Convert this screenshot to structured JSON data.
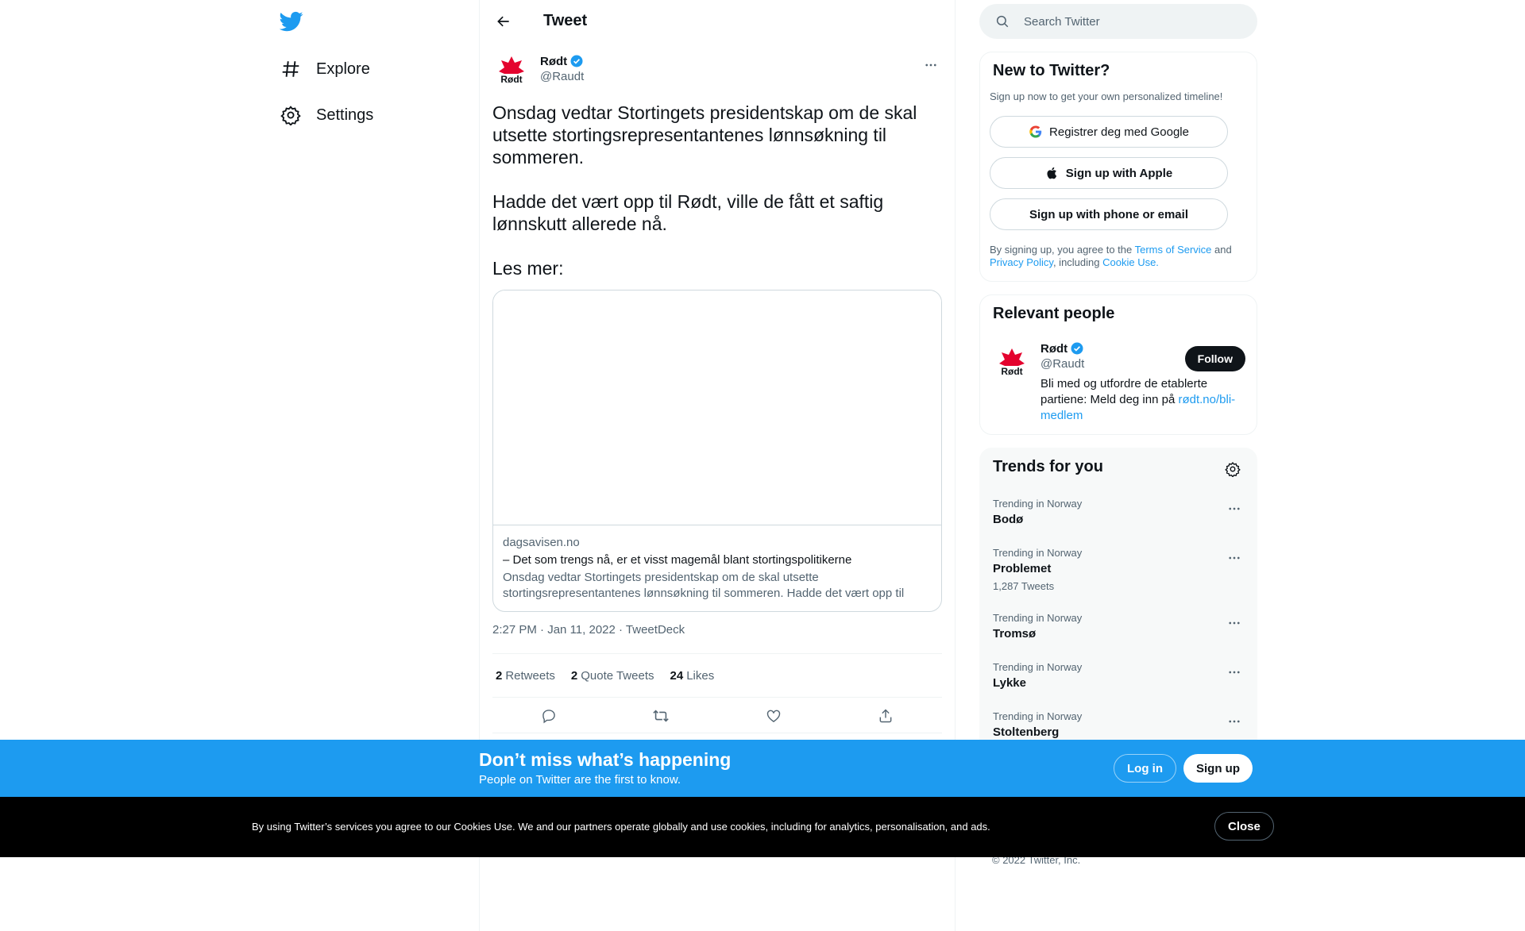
{
  "nav": {
    "items": [
      {
        "label": "Explore",
        "icon": "hashtag-icon"
      },
      {
        "label": "Settings",
        "icon": "gear-icon"
      }
    ]
  },
  "header": {
    "title": "Tweet"
  },
  "tweet": {
    "author_name": "Rødt",
    "author_handle": "@Raudt",
    "avatar_text": "Rødt",
    "paragraphs": [
      "Onsdag vedtar Stortingets presidentskap om de skal utsette stortingsrepresentantenes lønnsøkning til sommeren.",
      "Hadde det vært opp til Rødt, ville de fått et saftig lønnskutt allerede nå.",
      "Les mer:"
    ],
    "card": {
      "domain": "dagsavisen.no",
      "title": "– Det som trengs nå, er et visst magemål blant stortingspolitikerne",
      "description": "Onsdag vedtar Stortingets presidentskap om de skal utsette stortingsrepresentantenes lønnsøkning til sommeren. Hadde det vært opp til SV…"
    },
    "meta": {
      "time": "2:27 PM",
      "sep1": " · ",
      "date": "Jan 11, 2022",
      "sep2": " · ",
      "source": "TweetDeck"
    },
    "stats": {
      "retweets_count": "2",
      "retweets_label": "Retweets",
      "quotes_count": "2",
      "quotes_label": "Quote Tweets",
      "likes_count": "24",
      "likes_label": "Likes"
    }
  },
  "search": {
    "placeholder": "Search Twitter"
  },
  "signup_panel": {
    "title": "New to Twitter?",
    "subtitle": "Sign up now to get your own personalized timeline!",
    "google_label": "Registrer deg med Google",
    "apple_label": "Sign up with Apple",
    "phone_label": "Sign up with phone or email",
    "terms_prefix": "By signing up, you agree to the ",
    "terms_link": "Terms of Service",
    "terms_and": " and",
    "privacy_link": "Privacy Policy",
    "terms_including": ", including ",
    "cookie_link": "Cookie Use."
  },
  "relevant_people": {
    "title": "Relevant people",
    "name": "Rødt",
    "handle": "@Raudt",
    "bio_text": "Bli med og utfordre de etablerte partiene: Meld deg inn på ",
    "bio_link": "rødt.no/bli-medlem",
    "follow_label": "Follow"
  },
  "trends": {
    "title": "Trends for you",
    "items": [
      {
        "category": "Trending in Norway",
        "name": "Bodø",
        "count": ""
      },
      {
        "category": "Trending in Norway",
        "name": "Problemet",
        "count": "1,287 Tweets"
      },
      {
        "category": "Trending in Norway",
        "name": "Tromsø",
        "count": ""
      },
      {
        "category": "Trending in Norway",
        "name": "Lykke",
        "count": ""
      },
      {
        "category": "Trending in Norway",
        "name": "Stoltenberg",
        "count": ""
      }
    ]
  },
  "footer": {
    "copyright": "© 2022 Twitter, Inc."
  },
  "bottom_bar": {
    "title": "Don’t miss what’s happening",
    "subtitle": "People on Twitter are the first to know.",
    "login_label": "Log in",
    "signup_label": "Sign up"
  },
  "cookie_bar": {
    "text": "By using Twitter’s services you agree to our Cookies Use. We and our partners operate globally and use cookies, including for analytics, personalisation, and ads.",
    "close_label": "Close"
  },
  "colors": {
    "accent": "#1d9bf0",
    "text": "#0f1419",
    "muted": "#536471",
    "brand_red": "#e4032e"
  }
}
